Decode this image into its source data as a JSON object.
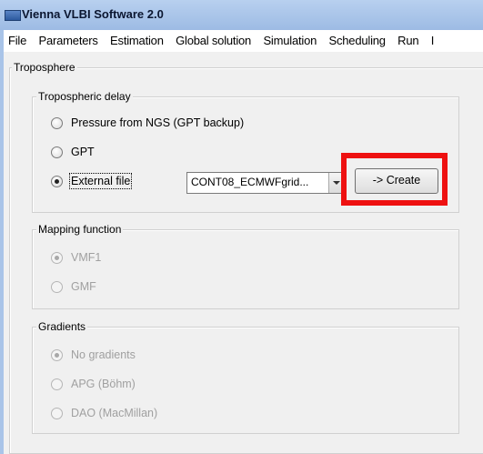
{
  "window": {
    "title": "Vienna VLBI Software 2.0",
    "title_icon": "app-icon"
  },
  "menu": [
    "File",
    "Parameters",
    "Estimation",
    "Global solution",
    "Simulation",
    "Scheduling",
    "Run",
    "I"
  ],
  "troposphere": {
    "legend": "Troposphere",
    "delay": {
      "legend": "Tropospheric delay",
      "options": [
        "Pressure from NGS (GPT backup)",
        "GPT",
        "External file"
      ],
      "selected": "External file",
      "file_combo_value": "CONT08_ECMWFgrid...",
      "create_button": "-> Create"
    },
    "mapping": {
      "legend": "Mapping function",
      "options": [
        "VMF1",
        "GMF"
      ],
      "selected": "VMF1",
      "enabled": false
    },
    "gradients": {
      "legend": "Gradients",
      "options": [
        "No gradients",
        "APG (Böhm)",
        "DAO (MacMillan)"
      ],
      "selected": "No gradients",
      "enabled": false
    }
  },
  "colors": {
    "highlight": "#ee1111",
    "titlebar": "#a9c4e8",
    "panel": "#f0f0f0"
  }
}
